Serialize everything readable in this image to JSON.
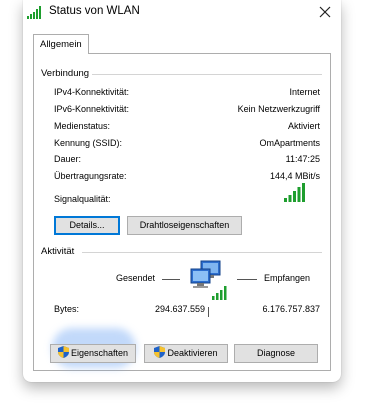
{
  "window": {
    "title": "Status von WLAN"
  },
  "tabs": [
    {
      "label": "Allgemein"
    }
  ],
  "connection": {
    "section_label": "Verbindung",
    "rows": [
      {
        "label": "IPv4-Konnektivität:",
        "value": "Internet"
      },
      {
        "label": "IPv6-Konnektivität:",
        "value": "Kein Netzwerkzugriff"
      },
      {
        "label": "Medienstatus:",
        "value": "Aktiviert"
      },
      {
        "label": "Kennung (SSID):",
        "value": "OmApartments"
      },
      {
        "label": "Dauer:",
        "value": "11:47:25"
      },
      {
        "label": "Übertragungsrate:",
        "value": "144,4 MBit/s"
      }
    ],
    "signal_label": "Signalqualität:",
    "signal_bars_lit": 5,
    "signal_bars_total": 5,
    "details_button": "Details...",
    "wireless_props_button": "Drahtloseigenschaften"
  },
  "activity": {
    "section_label": "Aktivität",
    "sent_label": "Gesendet",
    "received_label": "Empfangen",
    "bytes_label": "Bytes:",
    "bytes_sent": "294.637.559",
    "bytes_received": "6.176.757.837"
  },
  "buttons": {
    "properties": "Eigenschaften",
    "disable": "Deaktivieren",
    "diagnose": "Diagnose"
  },
  "colors": {
    "signal_green": "#1e9e2e",
    "accent_blue": "#0078d7"
  },
  "icons": {
    "title": "wifi-signal-icon",
    "close": "close-icon",
    "network": "network-computers-icon",
    "shield": "uac-shield-icon"
  }
}
